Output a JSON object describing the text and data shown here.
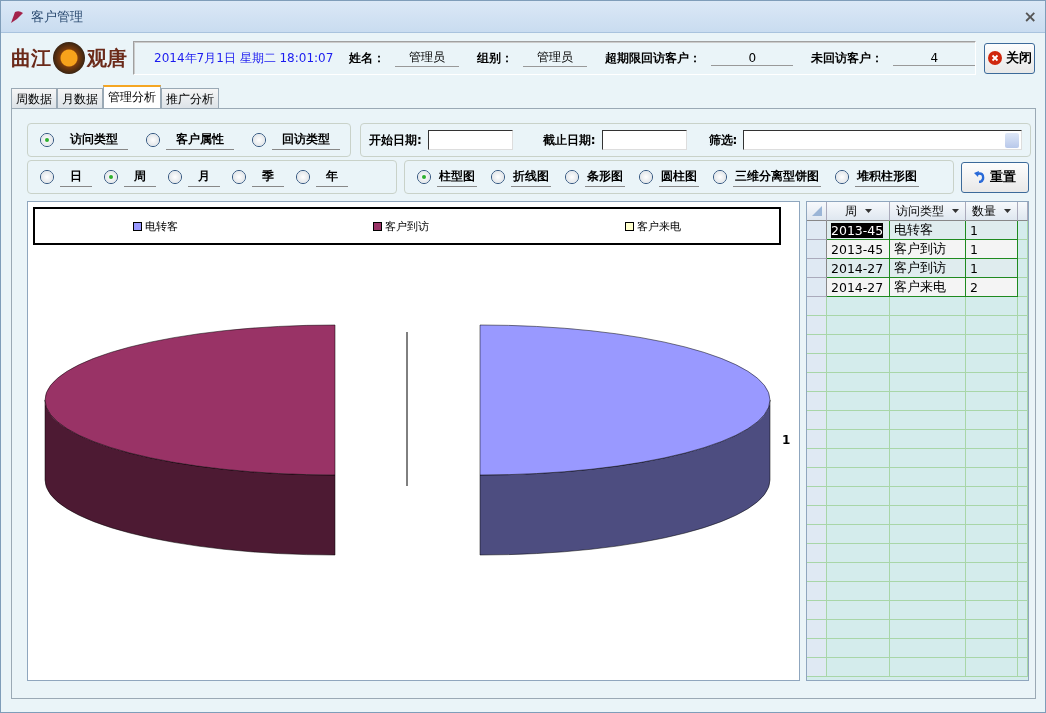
{
  "window": {
    "title": "客户管理",
    "close": "×"
  },
  "logo": {
    "left": "曲江",
    "right": "观唐"
  },
  "header": {
    "datetime": "2014年7月1日 星期二 18:01:07",
    "fields": [
      {
        "label": "姓名：",
        "value": "管理员"
      },
      {
        "label": "组别：",
        "value": "管理员"
      },
      {
        "label": "超期限回访客户：",
        "value": "0"
      },
      {
        "label": "未回访客户：",
        "value": "4"
      }
    ]
  },
  "close_button": "关闭",
  "tabs": [
    {
      "label": "周数据",
      "selected": false
    },
    {
      "label": "月数据",
      "selected": false
    },
    {
      "label": "管理分析",
      "selected": true
    },
    {
      "label": "推广分析",
      "selected": false
    }
  ],
  "analysis_type": [
    {
      "label": "访问类型",
      "selected": true
    },
    {
      "label": "客户属性",
      "selected": false
    },
    {
      "label": "回访类型",
      "selected": false
    }
  ],
  "date_filters": {
    "start_label": "开始日期:",
    "end_label": "截止日期:",
    "filter_label": "筛选:"
  },
  "period": [
    {
      "label": "日",
      "selected": false
    },
    {
      "label": "周",
      "selected": true
    },
    {
      "label": "月",
      "selected": false
    },
    {
      "label": "季",
      "selected": false
    },
    {
      "label": "年",
      "selected": false
    }
  ],
  "chart_types": [
    {
      "label": "柱型图",
      "selected": true
    },
    {
      "label": "折线图",
      "selected": false
    },
    {
      "label": "条形图",
      "selected": false
    },
    {
      "label": "圆柱图",
      "selected": false
    },
    {
      "label": "三维分离型饼图",
      "selected": false
    },
    {
      "label": "堆积柱形图",
      "selected": false
    }
  ],
  "reset_button": "重置",
  "chart": {
    "legend": [
      {
        "label": "电转客",
        "color": "#9999ff"
      },
      {
        "label": "客户到访",
        "color": "#993366"
      },
      {
        "label": "客户来电",
        "color": "#ffffcc"
      }
    ],
    "data_label": "1"
  },
  "grid": {
    "columns": [
      "周",
      "访问类型",
      "数量"
    ],
    "rows": [
      {
        "cells": [
          "2013-45",
          "电转客",
          "1"
        ],
        "selected": true
      },
      {
        "cells": [
          "2013-45",
          "客户到访",
          "1"
        ],
        "selected": false
      },
      {
        "cells": [
          "2014-27",
          "客户到访",
          "1"
        ],
        "selected": false
      },
      {
        "cells": [
          "2014-27",
          "客户来电",
          "2"
        ],
        "selected": false
      }
    ]
  }
}
